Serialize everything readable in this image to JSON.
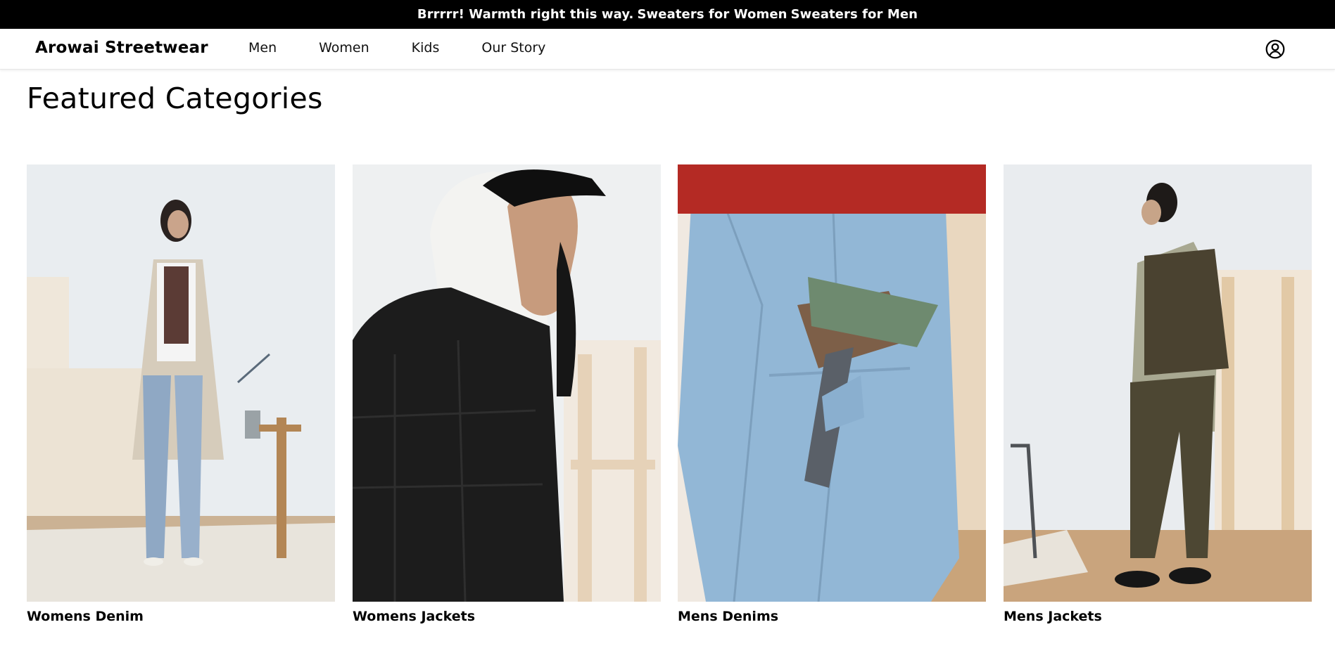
{
  "announcement": {
    "text": "Brrrrr! Warmth right this way.",
    "links": [
      "Sweaters for Women",
      "Sweaters for Men"
    ]
  },
  "header": {
    "brand": "Arowai Streetwear",
    "nav": [
      "Men",
      "Women",
      "Kids",
      "Our Story"
    ],
    "account_icon": "user-circle-icon"
  },
  "main": {
    "title": "Featured Categories",
    "categories": [
      {
        "label": "Womens Denim"
      },
      {
        "label": "Womens Jackets"
      },
      {
        "label": "Mens Denims"
      },
      {
        "label": "Mens Jackets"
      }
    ]
  },
  "colors": {
    "announcement_bg": "#000000",
    "announcement_text": "#ffffff",
    "text": "#000000",
    "background": "#ffffff"
  }
}
